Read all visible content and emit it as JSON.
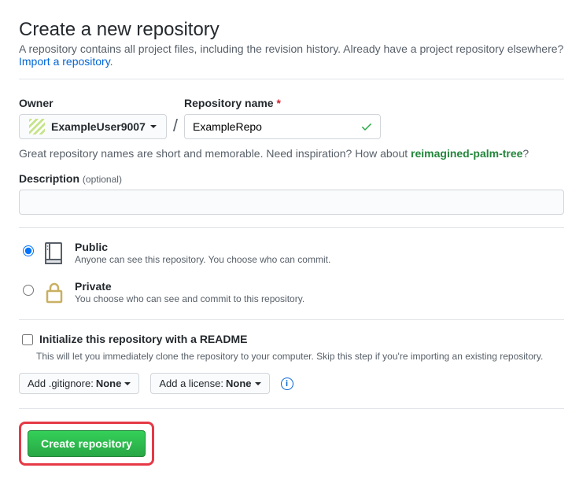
{
  "header": {
    "title": "Create a new repository",
    "description": "A repository contains all project files, including the revision history. Already have a project repository elsewhere?",
    "import_link": "Import a repository"
  },
  "owner": {
    "label": "Owner",
    "value": "ExampleUser9007"
  },
  "repo": {
    "label": "Repository name",
    "value": "ExampleRepo",
    "valid": true
  },
  "name_help": {
    "prefix": "Great repository names are short and memorable. Need inspiration? How about ",
    "suggestion": "reimagined-palm-tree",
    "suffix": "?"
  },
  "description": {
    "label": "Description",
    "optional": "(optional)",
    "value": ""
  },
  "visibility": {
    "public": {
      "title": "Public",
      "desc": "Anyone can see this repository. You choose who can commit.",
      "selected": true
    },
    "private": {
      "title": "Private",
      "desc": "You choose who can see and commit to this repository.",
      "selected": false
    }
  },
  "init": {
    "label": "Initialize this repository with a README",
    "desc": "This will let you immediately clone the repository to your computer. Skip this step if you're importing an existing repository.",
    "checked": false
  },
  "gitignore": {
    "prefix": "Add .gitignore: ",
    "value": "None"
  },
  "license": {
    "prefix": "Add a license: ",
    "value": "None"
  },
  "submit": {
    "label": "Create repository"
  }
}
